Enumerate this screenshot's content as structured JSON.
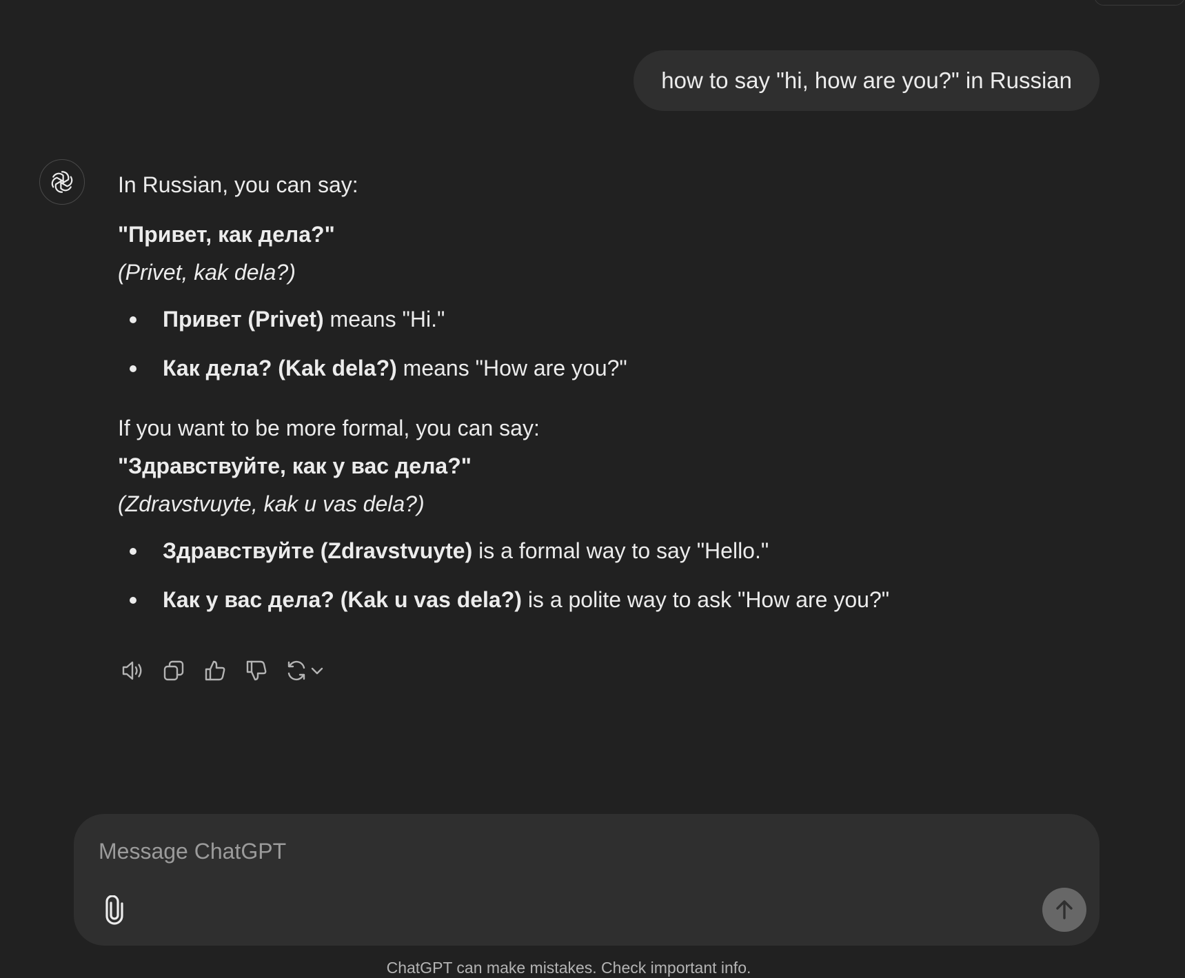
{
  "user_message": "how to say \"hi, how are you?\" in Russian",
  "assistant": {
    "intro": "In Russian, you can say:",
    "phrase1": "\"Привет, как дела?\"",
    "translit1": "(Privet, kak dela?)",
    "bullets1": [
      {
        "bold": "Привет (Privet)",
        "rest": " means \"Hi.\""
      },
      {
        "bold": "Как дела? (Kak dela?)",
        "rest": " means \"How are you?\""
      }
    ],
    "formal_intro": "If you want to be more formal, you can say:",
    "phrase2": "\"Здравствуйте, как у вас дела?\"",
    "translit2": "(Zdravstvuyte, kak u vas dela?)",
    "bullets2": [
      {
        "bold": "Здравствуйте (Zdravstvuyte)",
        "rest": " is a formal way to say \"Hello.\""
      },
      {
        "bold": "Как у вас дела? (Kak u vas dela?)",
        "rest": " is a polite way to ask \"How are you?\""
      }
    ]
  },
  "actions": {
    "icons": [
      "speaker-icon",
      "copy-icon",
      "thumbs-up-icon",
      "thumbs-down-icon",
      "regenerate-icon",
      "chevron-down-icon"
    ]
  },
  "composer": {
    "placeholder": "Message ChatGPT",
    "value": ""
  },
  "footer": {
    "disclaimer": "ChatGPT can make mistakes. Check important info."
  },
  "colors": {
    "background": "#212121",
    "bubble": "#2f2f2f",
    "text": "#ececec",
    "muted": "#b4b4b4",
    "send_button": "#676767"
  }
}
